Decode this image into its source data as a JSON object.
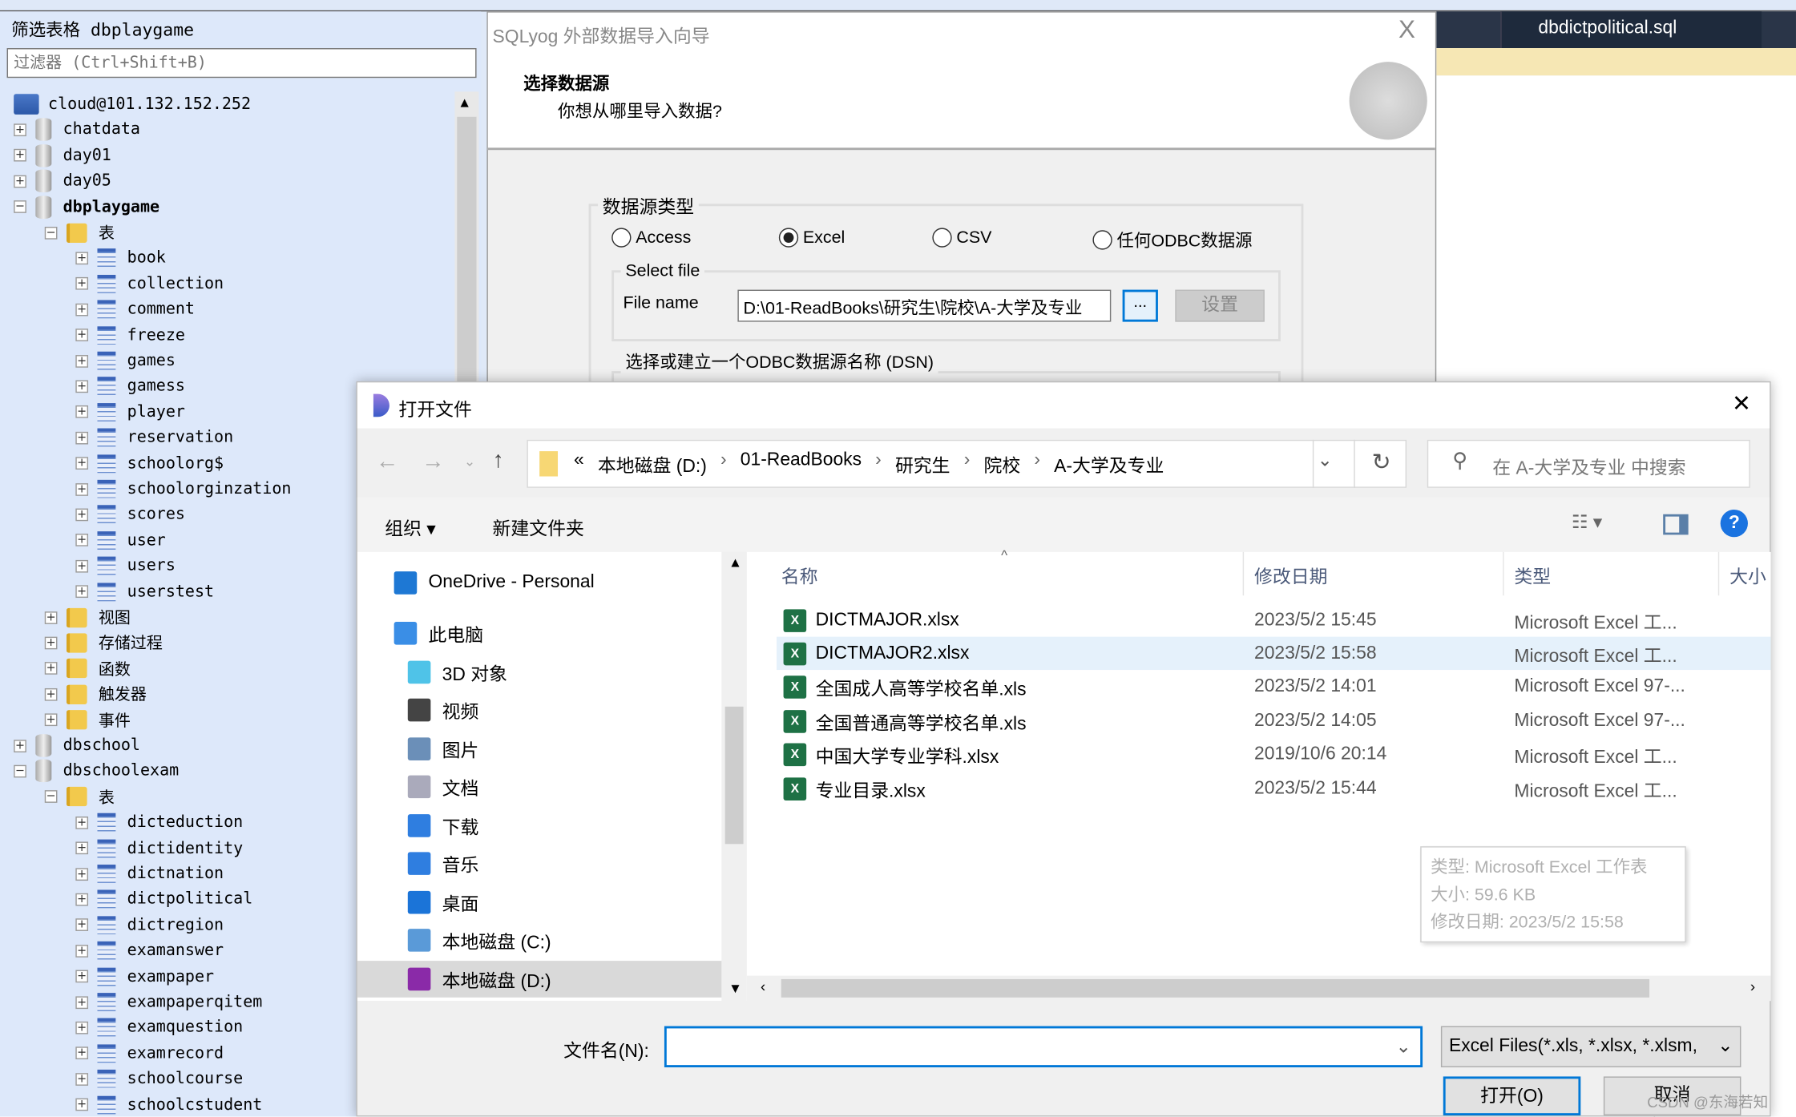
{
  "left_panel": {
    "filter_title": "筛选表格 dbplaygame",
    "filter_placeholder": "过滤器 (Ctrl+Shift+B)",
    "tree": [
      {
        "label": "cloud@101.132.152.252",
        "level": 0,
        "type": "server",
        "expander": ""
      },
      {
        "label": "chatdata",
        "level": 0,
        "type": "db",
        "expander": "+"
      },
      {
        "label": "day01",
        "level": 0,
        "type": "db",
        "expander": "+"
      },
      {
        "label": "day05",
        "level": 0,
        "type": "db",
        "expander": "+"
      },
      {
        "label": "dbplaygame",
        "level": 0,
        "type": "db",
        "expander": "-",
        "bold": true
      },
      {
        "label": "表",
        "level": 1,
        "type": "folder",
        "expander": "-"
      },
      {
        "label": "book",
        "level": 2,
        "type": "table",
        "expander": "+"
      },
      {
        "label": "collection",
        "level": 2,
        "type": "table",
        "expander": "+"
      },
      {
        "label": "comment",
        "level": 2,
        "type": "table",
        "expander": "+"
      },
      {
        "label": "freeze",
        "level": 2,
        "type": "table",
        "expander": "+"
      },
      {
        "label": "games",
        "level": 2,
        "type": "table",
        "expander": "+"
      },
      {
        "label": "gamess",
        "level": 2,
        "type": "table",
        "expander": "+"
      },
      {
        "label": "player",
        "level": 2,
        "type": "table",
        "expander": "+"
      },
      {
        "label": "reservation",
        "level": 2,
        "type": "table",
        "expander": "+"
      },
      {
        "label": "schoolorg$",
        "level": 2,
        "type": "table",
        "expander": "+"
      },
      {
        "label": "schoolorginzation",
        "level": 2,
        "type": "table",
        "expander": "+"
      },
      {
        "label": "scores",
        "level": 2,
        "type": "table",
        "expander": "+"
      },
      {
        "label": "user",
        "level": 2,
        "type": "table",
        "expander": "+"
      },
      {
        "label": "users",
        "level": 2,
        "type": "table",
        "expander": "+"
      },
      {
        "label": "userstest",
        "level": 2,
        "type": "table",
        "expander": "+"
      },
      {
        "label": "视图",
        "level": 1,
        "type": "folder",
        "expander": "+"
      },
      {
        "label": "存储过程",
        "level": 1,
        "type": "folder",
        "expander": "+"
      },
      {
        "label": "函数",
        "level": 1,
        "type": "folder",
        "expander": "+"
      },
      {
        "label": "触发器",
        "level": 1,
        "type": "folder",
        "expander": "+"
      },
      {
        "label": "事件",
        "level": 1,
        "type": "folder",
        "expander": "+"
      },
      {
        "label": "dbschool",
        "level": 0,
        "type": "db",
        "expander": "+"
      },
      {
        "label": "dbschoolexam",
        "level": 0,
        "type": "db",
        "expander": "-"
      },
      {
        "label": "表",
        "level": 1,
        "type": "folder",
        "expander": "-"
      },
      {
        "label": "dicteduction",
        "level": 2,
        "type": "table",
        "expander": "+"
      },
      {
        "label": "dictidentity",
        "level": 2,
        "type": "table",
        "expander": "+"
      },
      {
        "label": "dictnation",
        "level": 2,
        "type": "table",
        "expander": "+"
      },
      {
        "label": "dictpolitical",
        "level": 2,
        "type": "table",
        "expander": "+"
      },
      {
        "label": "dictregion",
        "level": 2,
        "type": "table",
        "expander": "+"
      },
      {
        "label": "examanswer",
        "level": 2,
        "type": "table",
        "expander": "+"
      },
      {
        "label": "exampaper",
        "level": 2,
        "type": "table",
        "expander": "+"
      },
      {
        "label": "exampaperqitem",
        "level": 2,
        "type": "table",
        "expander": "+"
      },
      {
        "label": "examquestion",
        "level": 2,
        "type": "table",
        "expander": "+"
      },
      {
        "label": "examrecord",
        "level": 2,
        "type": "table",
        "expander": "+"
      },
      {
        "label": "schoolcourse",
        "level": 2,
        "type": "table",
        "expander": "+"
      },
      {
        "label": "schoolcstudent",
        "level": 2,
        "type": "table",
        "expander": "+"
      }
    ]
  },
  "right_tab": {
    "label": "dbdictpolitical.sql"
  },
  "wizard": {
    "title": "SQLyog 外部数据导入向导",
    "close": "X",
    "heading": "选择数据源",
    "subheading": "你想从哪里导入数据?",
    "source_group": "数据源类型",
    "options": [
      {
        "label": "Access",
        "selected": false
      },
      {
        "label": "Excel",
        "selected": true
      },
      {
        "label": "CSV",
        "selected": false
      },
      {
        "label": "任何ODBC数据源",
        "selected": false
      }
    ],
    "select_file_group": "Select file",
    "file_name_label": "File name",
    "file_name_value": "D:\\01-ReadBooks\\研究生\\院校\\A-大学及专业",
    "browse": "...",
    "settings": "设置",
    "dsn_group": "选择或建立一个ODBC数据源名称 (DSN)"
  },
  "open_dialog": {
    "title": "打开文件",
    "close": "✕",
    "breadcrumb": [
      "«",
      "本地磁盘 (D:)",
      "01-ReadBooks",
      "研究生",
      "院校",
      "A-大学及专业"
    ],
    "search_placeholder": "在 A-大学及专业 中搜索",
    "organize": "组织 ▾",
    "new_folder": "新建文件夹",
    "nav": [
      {
        "label": "OneDrive - Personal",
        "icon": "cloud-icon",
        "color": "#1e78d4"
      },
      {
        "label": "此电脑",
        "icon": "computer-icon",
        "color": "#3a8ee6"
      },
      {
        "label": "3D 对象",
        "icon": "cube-icon",
        "color": "#4fc3e8"
      },
      {
        "label": "视频",
        "icon": "video-icon",
        "color": "#444"
      },
      {
        "label": "图片",
        "icon": "picture-icon",
        "color": "#6b8fb8"
      },
      {
        "label": "文档",
        "icon": "document-icon",
        "color": "#aab"
      },
      {
        "label": "下载",
        "icon": "download-icon",
        "color": "#2f7ee0"
      },
      {
        "label": "音乐",
        "icon": "music-icon",
        "color": "#2f7ee0"
      },
      {
        "label": "桌面",
        "icon": "desktop-icon",
        "color": "#1b74d8"
      },
      {
        "label": "本地磁盘 (C:)",
        "icon": "drive-icon",
        "color": "#5a9ad8"
      },
      {
        "label": "本地磁盘 (D:)",
        "icon": "drive-icon",
        "color": "#8a2aa8",
        "selected": true
      }
    ],
    "columns": [
      "名称",
      "修改日期",
      "类型",
      "大小"
    ],
    "files": [
      {
        "name": "DICTMAJOR.xlsx",
        "date": "2023/5/2 15:45",
        "type": "Microsoft Excel 工..."
      },
      {
        "name": "DICTMAJOR2.xlsx",
        "date": "2023/5/2 15:58",
        "type": "Microsoft Excel 工...",
        "selected": true
      },
      {
        "name": "全国成人高等学校名单.xls",
        "date": "2023/5/2 14:01",
        "type": "Microsoft Excel 97-..."
      },
      {
        "name": "全国普通高等学校名单.xls",
        "date": "2023/5/2 14:05",
        "type": "Microsoft Excel 97-..."
      },
      {
        "name": "中国大学专业学科.xlsx",
        "date": "2019/10/6 20:14",
        "type": "Microsoft Excel 工..."
      },
      {
        "name": "专业目录.xlsx",
        "date": "2023/5/2 15:44",
        "type": "Microsoft Excel 工..."
      }
    ],
    "tooltip": [
      "类型: Microsoft Excel 工作表",
      "大小: 59.6 KB",
      "修改日期: 2023/5/2 15:58"
    ],
    "filename_label": "文件名(N):",
    "filename_value": "",
    "filter_value": "Excel Files(*.xls, *.xlsx, *.xlsm,",
    "open": "打开(O)",
    "cancel": "取消",
    "watermark": "CSDN @东海若知意"
  }
}
